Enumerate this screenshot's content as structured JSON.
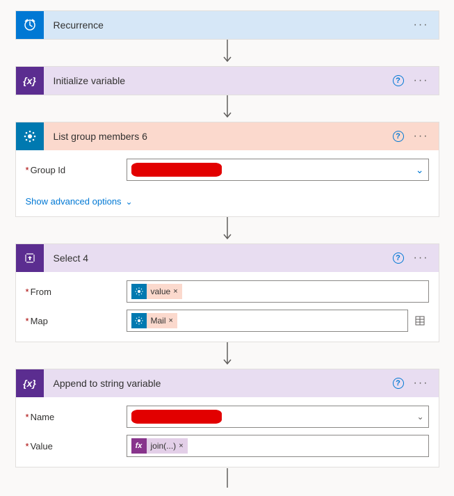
{
  "steps": {
    "recurrence": {
      "title": "Recurrence"
    },
    "initVar": {
      "title": "Initialize variable"
    },
    "listMembers": {
      "title": "List group members 6",
      "param_group_id": "Group Id",
      "advanced": "Show advanced options"
    },
    "select": {
      "title": "Select 4",
      "param_from": "From",
      "param_map": "Map",
      "token_value": "value",
      "token_mail": "Mail"
    },
    "append": {
      "title": "Append to string variable",
      "param_name": "Name",
      "param_value": "Value",
      "token_join": "join(...)"
    }
  }
}
